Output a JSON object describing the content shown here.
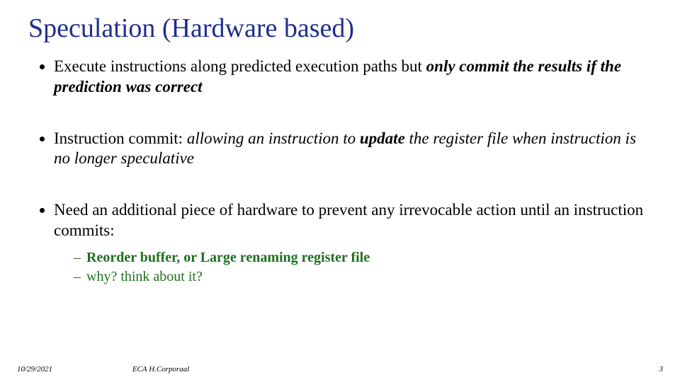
{
  "title": "Speculation  (Hardware based)",
  "b1_pre": "Execute instructions along predicted execution paths but ",
  "b1_bi": "only commit the results if the prediction was correct",
  "b2_pre": "Instruction commit:  ",
  "b2_it1": "allowing an instruction to ",
  "b2_b": "update",
  "b2_it2": " the register file when instruction is no longer speculative",
  "b3": "Need an additional piece of hardware to prevent any irrevocable action until an instruction commits:",
  "s1_b": "Reorder buffer, or Large renaming register file",
  "s2": "why? think about it?",
  "date": "10/29/2021",
  "source": "ECA  H.Corporaal",
  "page": "3"
}
